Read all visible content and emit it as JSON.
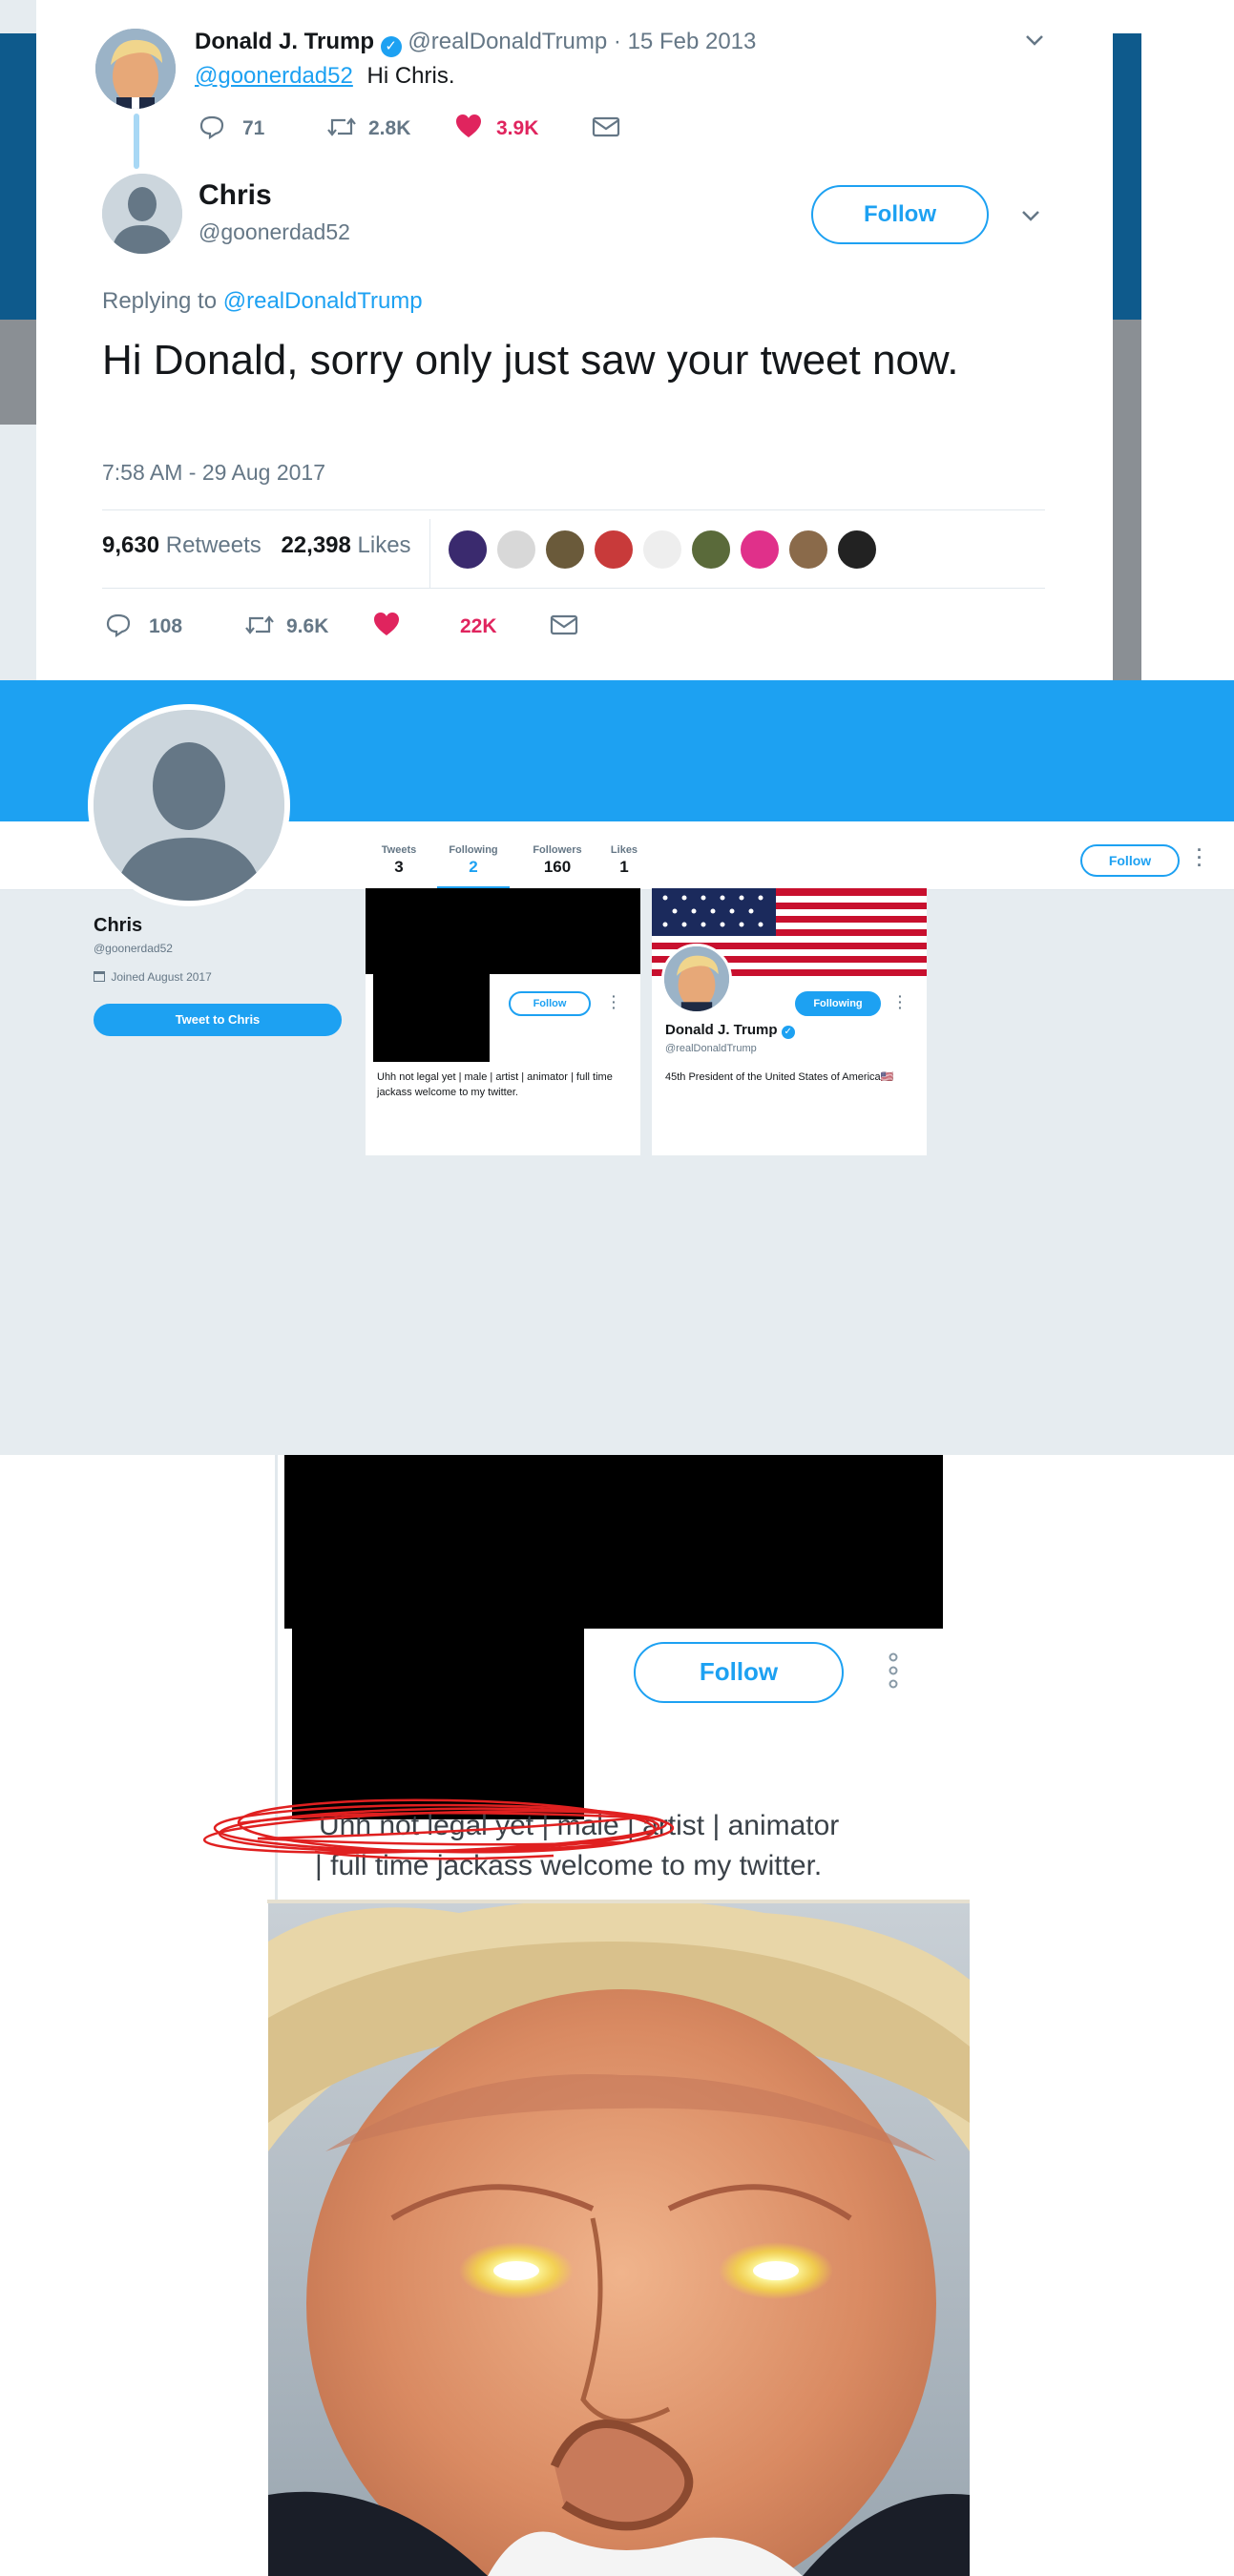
{
  "tweet_original": {
    "name": "Donald J. Trump",
    "handle": "@realDonaldTrump",
    "date": "· 15 Feb 2013",
    "mention": "@goonerdad52",
    "text": "Hi Chris.",
    "replies": "71",
    "retweets": "2.8K",
    "likes": "3.9K"
  },
  "tweet_reply": {
    "name": "Chris",
    "handle": "@goonerdad52",
    "follow_label": "Follow",
    "replying_to_prefix": "Replying to",
    "replying_to_handle": "@realDonaldTrump",
    "text": "Hi Donald, sorry only just saw your tweet now.",
    "timestamp": "7:58 AM - 29 Aug 2017",
    "retweet_count": "9,630",
    "retweet_label": "Retweets",
    "like_count": "22,398",
    "like_label": "Likes",
    "replies": "108",
    "retweets": "9.6K",
    "likes": "22K",
    "liker_avatar_colors": [
      "#3a2a6e",
      "#d8d8d8",
      "#6a5a3a",
      "#c83a3a",
      "#eeeeee",
      "#5a6a3a",
      "#e0308a",
      "#8a6a4a",
      "#222222"
    ]
  },
  "profile": {
    "stats": [
      {
        "label": "Tweets",
        "value": "3"
      },
      {
        "label": "Following",
        "value": "2"
      },
      {
        "label": "Followers",
        "value": "160"
      },
      {
        "label": "Likes",
        "value": "1"
      }
    ],
    "follow_label": "Follow",
    "name": "Chris",
    "handle": "@goonerdad52",
    "joined": "Joined August 2017",
    "tweet_to_label": "Tweet to Chris",
    "following_cards": [
      {
        "follow_label": "Follow",
        "bio": "Uhh not legal yet | male | artist | animator | full time jackass welcome to my twitter."
      },
      {
        "name": "Donald J. Trump",
        "handle": "@realDonaldTrump",
        "follow_label": "Following",
        "bio": "45th President of the United States of America🇺🇸"
      }
    ]
  },
  "zoom": {
    "follow_label": "Follow",
    "bio_line1": "Uhh not legal yet | male | artist | animator",
    "bio_line2": "| full time jackass welcome to my twitter."
  },
  "colors": {
    "twitter_blue": "#1da1f2",
    "like_pink": "#e0245e",
    "muted": "#657786",
    "background": "#e6ecf0",
    "scribble_red": "#e02020"
  }
}
